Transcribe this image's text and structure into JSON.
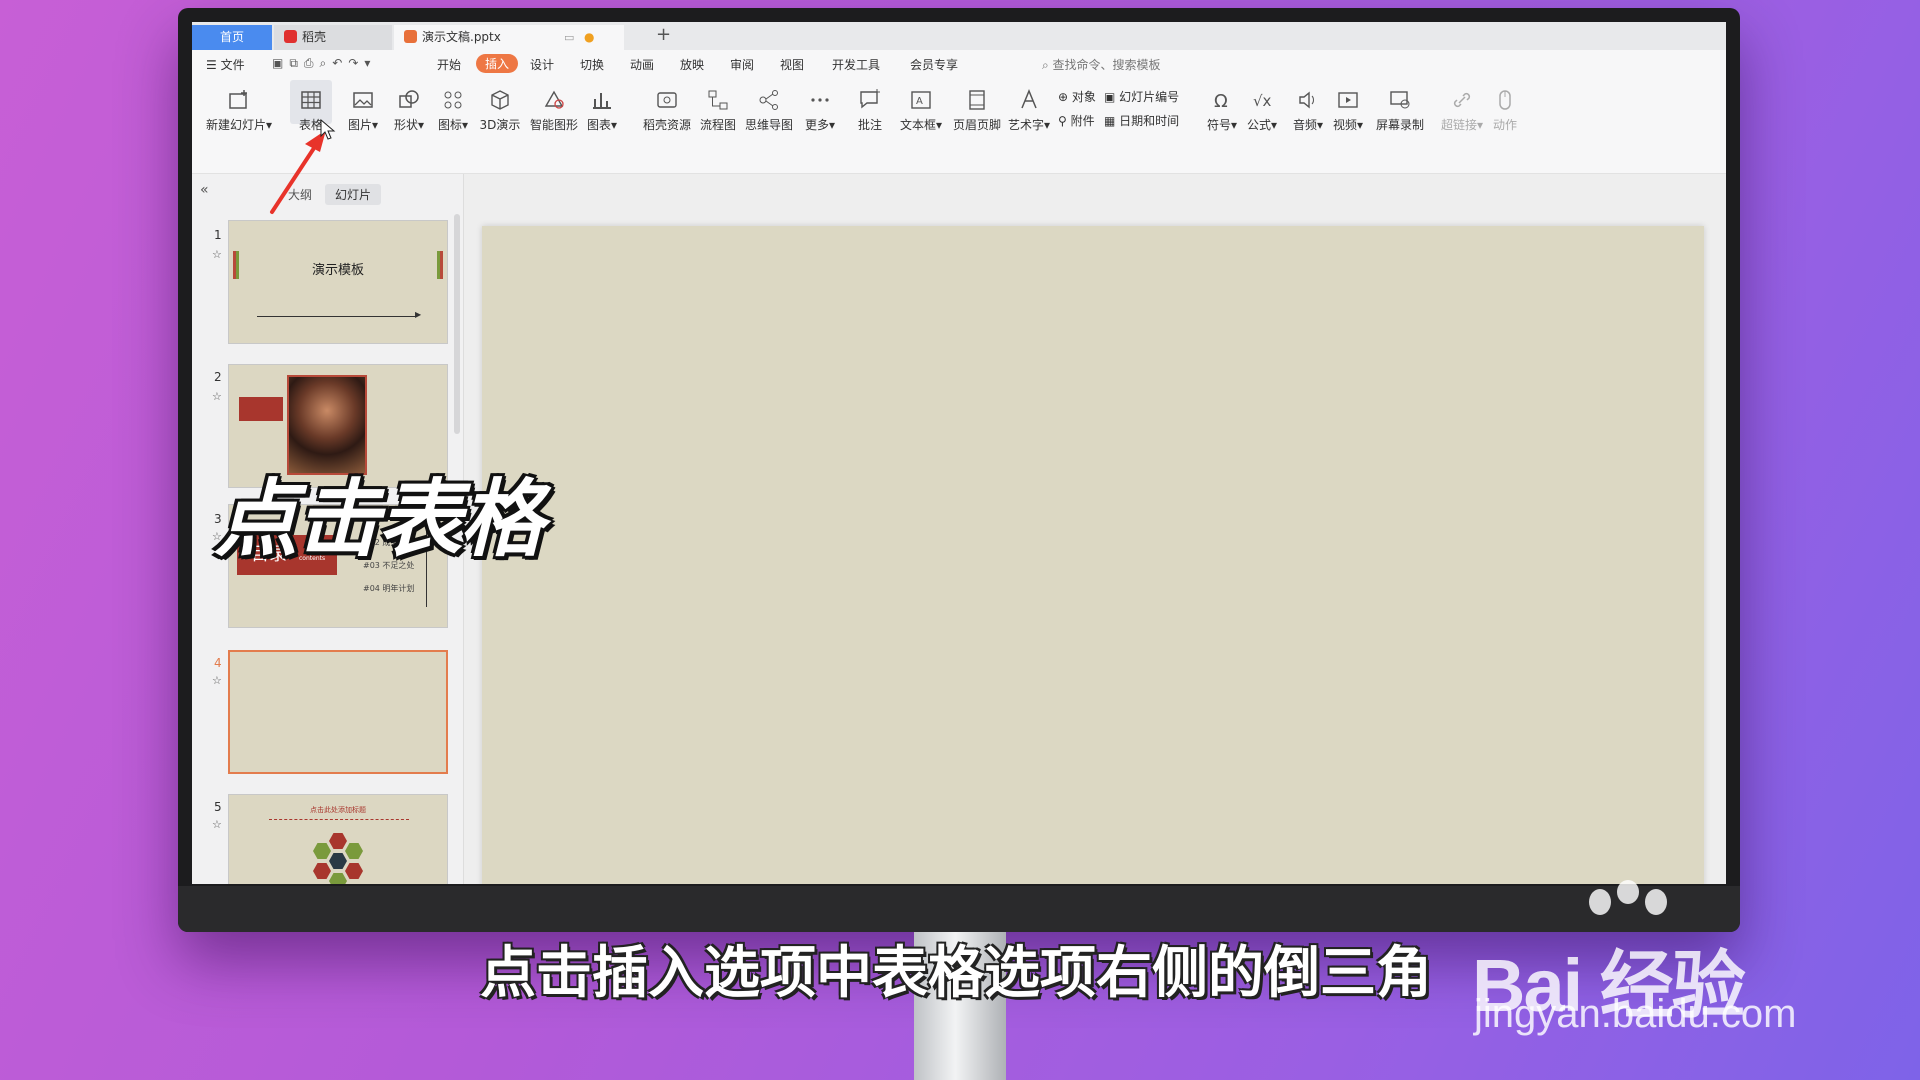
{
  "tabs": {
    "home": "首页",
    "daoke": "稻壳",
    "doc": "演示文稿.pptx",
    "new_tab": "+"
  },
  "menu": {
    "file": "☰ 文件",
    "items": [
      "开始",
      "插入",
      "设计",
      "切换",
      "动画",
      "放映",
      "审阅",
      "视图",
      "开发工具",
      "会员专享"
    ],
    "active": "插入",
    "search": "查找命令、搜索模板"
  },
  "ribbon": {
    "new_slide": "新建幻灯片",
    "table": "表格",
    "picture": "图片",
    "shape": "形状",
    "icon": "图标",
    "3d": "3D演示",
    "smart_graphic": "智能图形",
    "chart": "图表",
    "daoke_resource": "稻壳资源",
    "flowchart": "流程图",
    "mindmap": "思维导图",
    "more": "更多",
    "comment": "批注",
    "textbox": "文本框",
    "header_footer": "页眉页脚",
    "wordart": "艺术字",
    "object": "对象",
    "attachment": "附件",
    "slide_number": "幻灯片编号",
    "datetime": "日期和时间",
    "symbol": "符号",
    "formula": "公式",
    "audio": "音频",
    "video": "视频",
    "screen_record": "屏幕录制",
    "hyperlink": "超链接",
    "action": "动作"
  },
  "panel": {
    "collapse": "«",
    "outline_tab": "大纲",
    "slides_tab": "幻灯片",
    "slides": [
      {
        "num": "1",
        "title": "演示模板"
      },
      {
        "num": "2"
      },
      {
        "num": "3",
        "title": "目录",
        "sub": "contents",
        "items": [
          "#02  成果展示",
          "#03  不足之处",
          "#04  明年计划"
        ]
      },
      {
        "num": "4"
      },
      {
        "num": "5",
        "title": "点击此处添加标题"
      }
    ]
  },
  "overlay": {
    "caption": "点击表格",
    "subtitle": "点击插入选项中表格选项右侧的倒三角"
  },
  "watermark": {
    "brand": "Bai 经验",
    "url": "jingyan.baidu.com"
  }
}
